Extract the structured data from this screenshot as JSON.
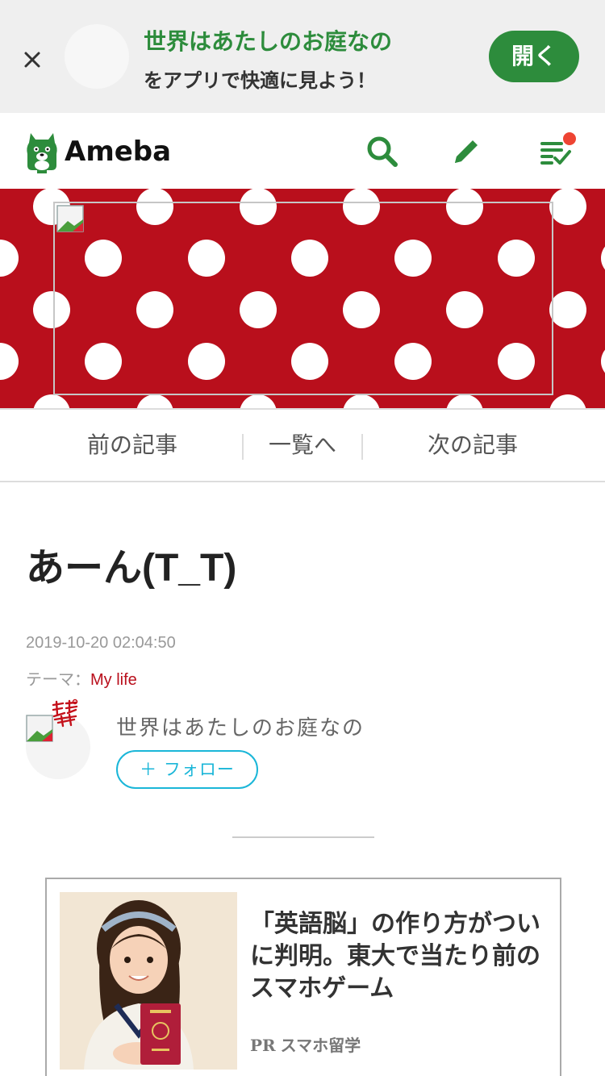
{
  "app_banner": {
    "title": "世界はあたしのお庭なの",
    "subtitle": "をアプリで快適に見よう！",
    "open_label": "開く"
  },
  "header": {
    "logo_text": "Ameba",
    "icons": [
      "search-icon",
      "pencil-icon",
      "checklist-icon"
    ],
    "brand_color": "#2d8c3c",
    "notification_color": "#ee4433"
  },
  "hero": {
    "background_color": "#b90f1c",
    "pattern": "white polka dots"
  },
  "article_nav": {
    "prev": "前の記事",
    "list": "一覧へ",
    "next": "次の記事"
  },
  "entry": {
    "title": "あーん(T_T)",
    "date": "2019-10-20 02:04:50",
    "theme_label": "テーマ：",
    "theme_value": "My life"
  },
  "author": {
    "name": "世界はあたしのお庭なの",
    "follow_label": "＋ フォロー",
    "follow_color": "#1ab6d8"
  },
  "ad": {
    "title": "「英語脳」の作り方がついに判明。東大で当たり前のスマホゲーム",
    "pr_tag": "PR",
    "sponsor": "スマホ留学"
  }
}
